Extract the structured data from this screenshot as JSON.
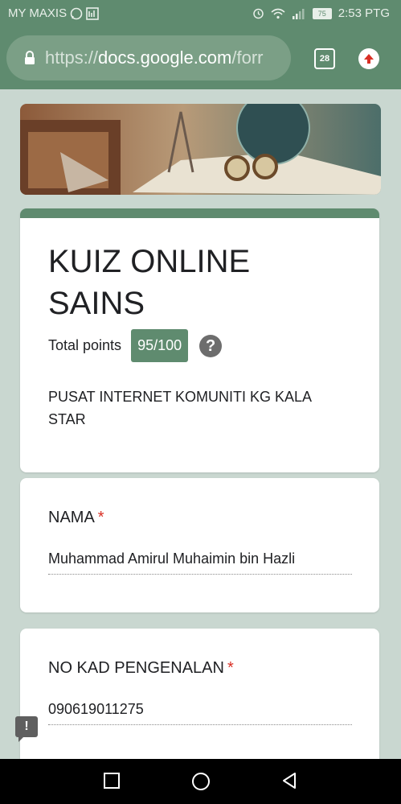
{
  "status_bar": {
    "carrier": "MY MAXIS",
    "battery": "75",
    "time": "2:53 PTG"
  },
  "browser": {
    "url_scheme": "https://",
    "url_host": "docs.google.com",
    "url_path": "/forr",
    "tab_count": "28"
  },
  "form": {
    "title": "KUIZ ONLINE SAINS",
    "points_label": "Total points",
    "score": "95/100",
    "help_symbol": "?",
    "description": "PUSAT INTERNET KOMUNITI KG KALA STAR"
  },
  "questions": [
    {
      "label": "NAMA",
      "required_mark": "*",
      "answer": "Muhammad Amirul Muhaimin bin Hazli"
    },
    {
      "label": "NO KAD PENGENALAN",
      "required_mark": "*",
      "answer": "090619011275"
    }
  ],
  "feedback": {
    "symbol": "!"
  },
  "colors": {
    "theme": "#5f8b6f",
    "required": "#d93025"
  }
}
